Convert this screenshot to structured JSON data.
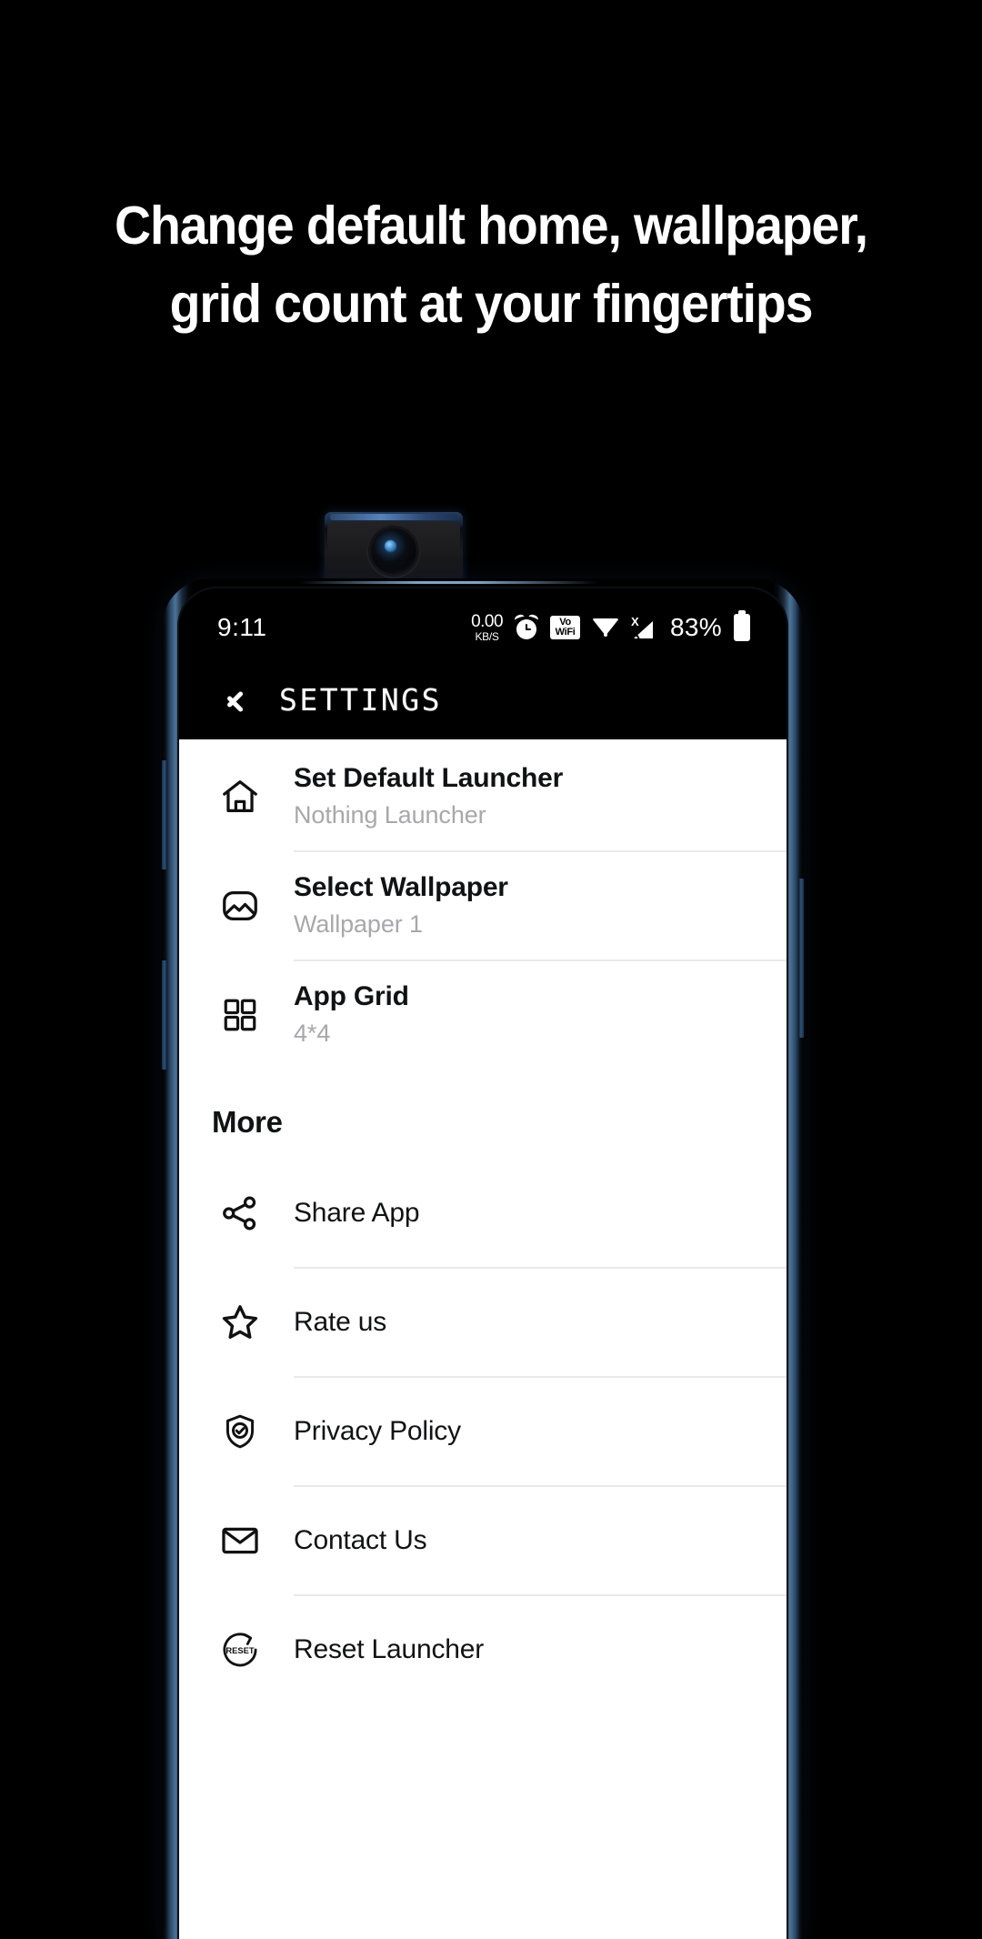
{
  "promo": {
    "headline_line1": "Change default home, wallpaper,",
    "headline_line2": "grid count at your fingertips",
    "background_color": "#000000",
    "text_color": "#ffffff"
  },
  "device": {
    "type": "pop-up-camera-phone",
    "frame_accent_color": "#4d7397"
  },
  "statusbar": {
    "time": "9:11",
    "network_speed_value": "0.00",
    "network_speed_unit": "KB/S",
    "alarm_icon": "alarm-clock-icon",
    "vowifi_line1": "Vo",
    "vowifi_line2": "WiFi",
    "wifi_icon": "wifi-icon",
    "signal_icon": "signal-no-service-icon",
    "signal_badge": "X",
    "battery_percent": "83%",
    "battery_icon": "battery-icon"
  },
  "appbar": {
    "back_icon": "back-chevron-icon",
    "title": "SETTINGS"
  },
  "settings": {
    "items": [
      {
        "icon": "home-icon",
        "title": "Set Default Launcher",
        "subtitle": "Nothing Launcher"
      },
      {
        "icon": "image-icon",
        "title": "Select Wallpaper",
        "subtitle": "Wallpaper 1"
      },
      {
        "icon": "grid-icon",
        "title": "App Grid",
        "subtitle": "4*4"
      }
    ]
  },
  "more": {
    "section_label": "More",
    "items": [
      {
        "icon": "share-icon",
        "title": "Share App"
      },
      {
        "icon": "star-icon",
        "title": "Rate us"
      },
      {
        "icon": "shield-check-icon",
        "title": "Privacy Policy"
      },
      {
        "icon": "envelope-icon",
        "title": "Contact Us"
      },
      {
        "icon": "reset-icon",
        "title": "Reset Launcher",
        "icon_label": "RESET"
      }
    ]
  },
  "colors": {
    "sheet_background": "#ffffff",
    "title_text": "#111213",
    "subtitle_text": "#a8a8aa",
    "divider": "#e9e9ea",
    "appbar_background": "#000000"
  }
}
